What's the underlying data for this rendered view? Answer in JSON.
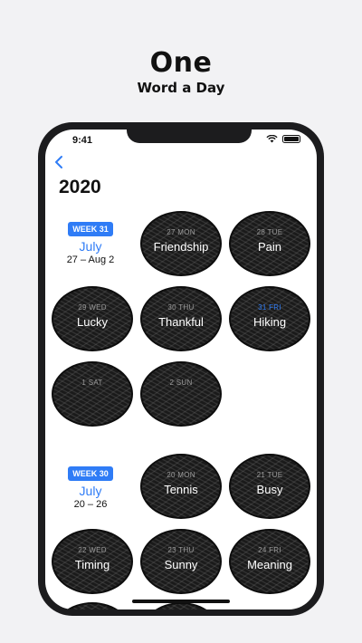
{
  "promo": {
    "title": "One",
    "subtitle": "Word a Day"
  },
  "status_bar": {
    "time": "9:41"
  },
  "header": {
    "year": "2020"
  },
  "weeks": [
    {
      "badge": "WEEK 31",
      "month": "July",
      "range": "27 – Aug 2",
      "days": [
        {
          "date": "27 MON",
          "word": "Friendship",
          "today": false
        },
        {
          "date": "28 TUE",
          "word": "Pain",
          "today": false
        },
        {
          "date": "29 WED",
          "word": "Lucky",
          "today": false
        },
        {
          "date": "30 THU",
          "word": "Thankful",
          "today": false
        },
        {
          "date": "31 FRI",
          "word": "Hiking",
          "today": true
        },
        {
          "date": "1 SAT",
          "word": "",
          "today": false
        },
        {
          "date": "2 SUN",
          "word": "",
          "today": false
        }
      ]
    },
    {
      "badge": "WEEK 30",
      "month": "July",
      "range": "20 – 26",
      "days": [
        {
          "date": "20 MON",
          "word": "Tennis",
          "today": false
        },
        {
          "date": "21 TUE",
          "word": "Busy",
          "today": false
        },
        {
          "date": "22 WED",
          "word": "Timing",
          "today": false
        },
        {
          "date": "23 THU",
          "word": "Sunny",
          "today": false
        },
        {
          "date": "24 FRI",
          "word": "Meaning",
          "today": false
        }
      ]
    }
  ],
  "colors": {
    "accent": "#2f7cf6",
    "circle": "#222222",
    "phone_frame": "#1c1c1e"
  }
}
